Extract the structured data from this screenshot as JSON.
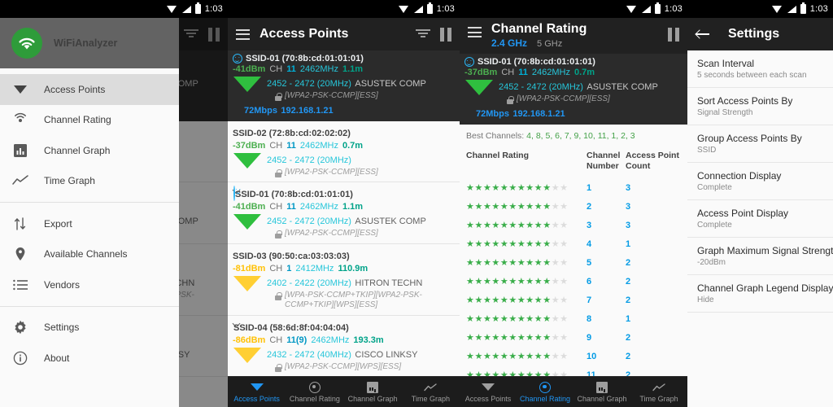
{
  "status_bar": {
    "time": "1:03",
    "icons": [
      "wifi-icon",
      "signal-icon",
      "battery-icon"
    ]
  },
  "colors": {
    "accent_blue": "#2196f3",
    "green_good": "#4caf50",
    "amber_warn": "#ffc107",
    "cyan_freq": "#26c6da",
    "star_on": "#3aae4a",
    "star_off": "#dcdcdc",
    "appbar": "#212121"
  },
  "drawer": {
    "app_name": "WiFiAnalyzer",
    "items": [
      {
        "label": "Access Points",
        "icon": "wifi-wedge-icon",
        "selected": true
      },
      {
        "label": "Channel Rating",
        "icon": "radar-icon",
        "selected": false
      },
      {
        "label": "Channel Graph",
        "icon": "bar-chart-icon",
        "selected": false
      },
      {
        "label": "Time Graph",
        "icon": "line-chart-icon",
        "selected": false
      }
    ],
    "items2": [
      {
        "label": "Export",
        "icon": "export-arrows-icon"
      },
      {
        "label": "Available Channels",
        "icon": "map-pin-icon"
      },
      {
        "label": "Vendors",
        "icon": "list-icon"
      }
    ],
    "items3": [
      {
        "label": "Settings",
        "icon": "gear-icon"
      },
      {
        "label": "About",
        "icon": "info-icon"
      }
    ]
  },
  "panel_access_points": {
    "title": "Access Points",
    "icons": [
      "menu-icon",
      "filter-icon",
      "pause-icon"
    ],
    "connected": {
      "ssid": "SSID-01 (70:8b:cd:01:01:01)",
      "dbm": "-41dBm",
      "ch_label": "CH",
      "channel": "11",
      "frequency": "2462MHz",
      "distance": "1.1m",
      "range": "2452 - 2472 (20MHz)",
      "vendor": "ASUSTEK COMP",
      "security": "[WPA2-PSK-CCMP][ESS]",
      "link_speed": "72Mbps",
      "ip": "192.168.1.21",
      "signal_level": "good"
    },
    "list": [
      {
        "ssid": "SSID-02 (72:8b:cd:02:02:02)",
        "dbm": "-37dBm",
        "ch_label": "CH",
        "channel": "11",
        "frequency": "2462MHz",
        "distance": "0.7m",
        "range": "2452 - 2472 (20MHz)",
        "vendor": "",
        "security": "[WPA2-PSK-CCMP][ESS]",
        "signal_level": "good",
        "expandable": false,
        "connected_face": false
      },
      {
        "ssid": "SSID-01 (70:8b:cd:01:01:01)",
        "dbm": "-41dBm",
        "ch_label": "CH",
        "channel": "11",
        "frequency": "2462MHz",
        "distance": "1.1m",
        "range": "2452 - 2472 (20MHz)",
        "vendor": "ASUSTEK COMP",
        "security": "[WPA2-PSK-CCMP][ESS]",
        "signal_level": "good",
        "expandable": true,
        "connected_face": true
      },
      {
        "ssid": "SSID-03 (90:50:ca:03:03:03)",
        "dbm": "-81dBm",
        "ch_label": "CH",
        "channel": "1",
        "frequency": "2412MHz",
        "distance": "110.9m",
        "range": "2402 - 2422 (20MHz)",
        "vendor": "HITRON TECHN",
        "security": "[WPA-PSK-CCMP+TKIP][WPA2-PSK-CCMP+TKIP][WPS][ESS]",
        "signal_level": "warn",
        "expandable": false,
        "connected_face": false
      },
      {
        "ssid": "SSID-04 (58:6d:8f:04:04:04)",
        "dbm": "-86dBm",
        "ch_label": "CH",
        "channel": "11(9)",
        "frequency": "2462MHz",
        "distance": "193.3m",
        "range": "2432 - 2472 (40MHz)",
        "vendor": "CISCO LINKSY",
        "security": "[WPA2-PSK-CCMP][WPS][ESS]",
        "signal_level": "warn",
        "expandable": true,
        "connected_face": false
      }
    ],
    "bottom_nav": [
      {
        "label": "Access Points",
        "icon": "wifi-wedge-icon",
        "active": true
      },
      {
        "label": "Channel Rating",
        "icon": "radar-icon",
        "active": false
      },
      {
        "label": "Channel Graph",
        "icon": "bar-chart-icon",
        "active": false
      },
      {
        "label": "Time Graph",
        "icon": "line-chart-icon",
        "active": false
      }
    ]
  },
  "panel_channel_rating": {
    "title": "Channel Rating",
    "band_active": "2.4 GHz",
    "band_inactive": "5 GHz",
    "icons": [
      "menu-icon",
      "pause-icon"
    ],
    "connected": {
      "ssid": "SSID-01 (70:8b:cd:01:01:01)",
      "dbm": "-37dBm",
      "ch_label": "CH",
      "channel": "11",
      "frequency": "2462MHz",
      "distance": "0.7m",
      "range": "2452 - 2472 (20MHz)",
      "vendor": "ASUSTEK COMP",
      "security": "[WPA2-PSK-CCMP][ESS]",
      "link_speed": "72Mbps",
      "ip": "192.168.1.21",
      "signal_level": "good"
    },
    "best_channels_label": "Best Channels:",
    "best_channels": "4, 8, 5, 6, 7, 9, 10, 11, 1, 2, 3",
    "table": {
      "headers": [
        "Channel Rating",
        "Channel Number",
        "Access Point Count"
      ],
      "max_stars": 12,
      "rows": [
        {
          "stars": 10,
          "channel": "1",
          "count": "3"
        },
        {
          "stars": 10,
          "channel": "2",
          "count": "3"
        },
        {
          "stars": 10,
          "channel": "3",
          "count": "3"
        },
        {
          "stars": 10,
          "channel": "4",
          "count": "1"
        },
        {
          "stars": 10,
          "channel": "5",
          "count": "2"
        },
        {
          "stars": 10,
          "channel": "6",
          "count": "2"
        },
        {
          "stars": 10,
          "channel": "7",
          "count": "2"
        },
        {
          "stars": 10,
          "channel": "8",
          "count": "1"
        },
        {
          "stars": 10,
          "channel": "9",
          "count": "2"
        },
        {
          "stars": 10,
          "channel": "10",
          "count": "2"
        },
        {
          "stars": 10,
          "channel": "11",
          "count": "2"
        }
      ]
    },
    "bottom_nav": [
      {
        "label": "Access Points",
        "icon": "wifi-wedge-icon",
        "active": false
      },
      {
        "label": "Channel Rating",
        "icon": "radar-icon",
        "active": true
      },
      {
        "label": "Channel Graph",
        "icon": "bar-chart-icon",
        "active": false
      },
      {
        "label": "Time Graph",
        "icon": "line-chart-icon",
        "active": false
      }
    ]
  },
  "panel_settings": {
    "title": "Settings",
    "back_icon": "back-arrow-icon",
    "items": [
      {
        "title": "Scan Interval",
        "value": "5 seconds between each scan"
      },
      {
        "title": "Sort Access Points By",
        "value": "Signal Strength"
      },
      {
        "title": "Group Access Points By",
        "value": "SSID"
      },
      {
        "title": "Connection Display",
        "value": "Complete"
      },
      {
        "title": "Access Point Display",
        "value": "Complete"
      },
      {
        "title": "Graph Maximum Signal Strength",
        "value": "-20dBm"
      },
      {
        "title": "Channel Graph Legend Display",
        "value": "Hide"
      }
    ]
  }
}
